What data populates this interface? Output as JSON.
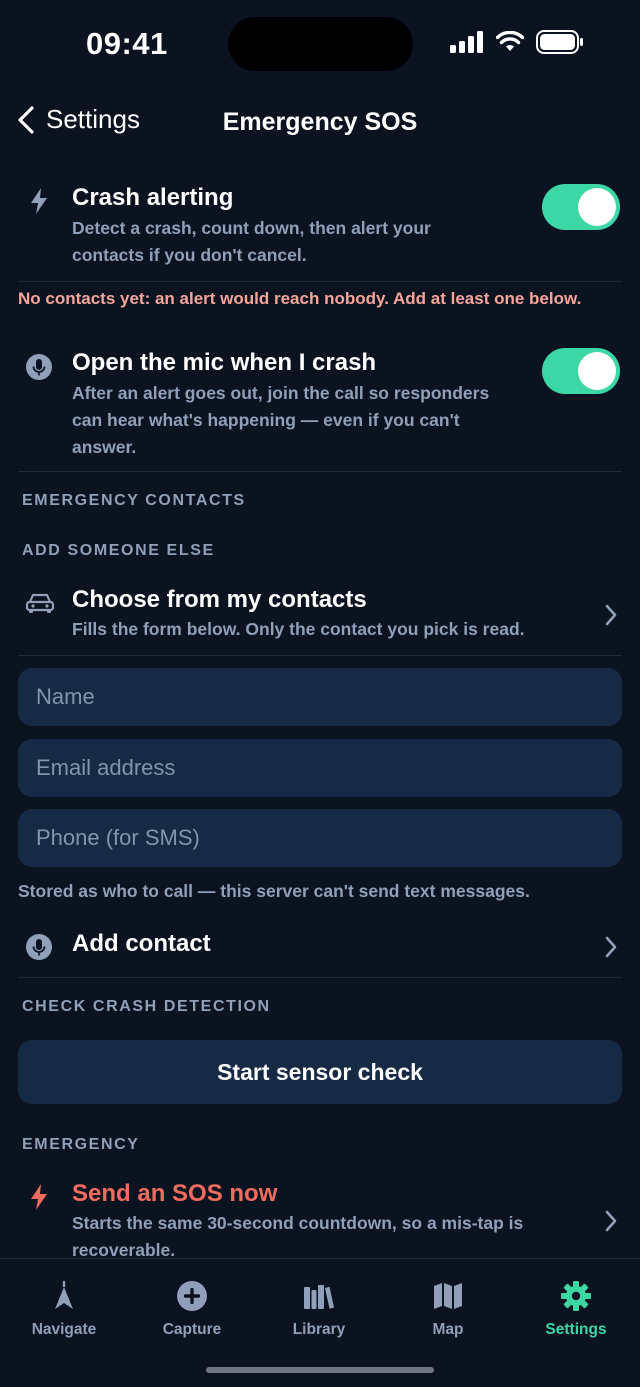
{
  "status": {
    "time": "09:41"
  },
  "header": {
    "back_label": "Settings",
    "title": "Emergency SOS"
  },
  "crash_alerting": {
    "title": "Crash alerting",
    "subtitle_1": "Detect a crash, count down, then alert your",
    "subtitle_2": "contacts if you don't cancel.",
    "enabled": true
  },
  "warning": "No contacts yet: an alert would reach nobody. Add at least one below.",
  "open_mic": {
    "title": "Open the mic when I crash",
    "subtitle_1": "After an alert goes out, join the call so responders",
    "subtitle_2": "can hear what's happening — even if you can't",
    "subtitle_3": "answer.",
    "enabled": true
  },
  "sections": {
    "emergency_contacts": "EMERGENCY CONTACTS",
    "add_someone": "ADD SOMEONE ELSE",
    "check_crash": "CHECK CRASH DETECTION",
    "emergency": "EMERGENCY"
  },
  "choose_contacts": {
    "title": "Choose from my contacts",
    "subtitle": "Fills the form below. Only the contact you pick is read."
  },
  "form": {
    "name_placeholder": "Name",
    "email_placeholder": "Email address",
    "phone_placeholder": "Phone (for SMS)",
    "hint": "Stored as who to call — this server can't send text messages.",
    "add_contact_label": "Add contact"
  },
  "sensor_check": {
    "label": "Start sensor check"
  },
  "sos": {
    "title": "Send an SOS now",
    "subtitle_1": "Starts the same 30-second countdown, so a mis-tap is",
    "subtitle_2": "recoverable."
  },
  "tabs": [
    {
      "label": "Navigate",
      "icon": "navigate-icon",
      "active": false
    },
    {
      "label": "Capture",
      "icon": "plus-circle-icon",
      "active": false
    },
    {
      "label": "Library",
      "icon": "books-icon",
      "active": false
    },
    {
      "label": "Map",
      "icon": "map-icon",
      "active": false
    },
    {
      "label": "Settings",
      "icon": "gear-icon",
      "active": true
    }
  ],
  "colors": {
    "accent": "#3dd7a6",
    "danger": "#f06c5f",
    "background": "#0b1220",
    "card": "#172a45",
    "muted": "#8fa0b8",
    "warning": "#f6a59b"
  }
}
